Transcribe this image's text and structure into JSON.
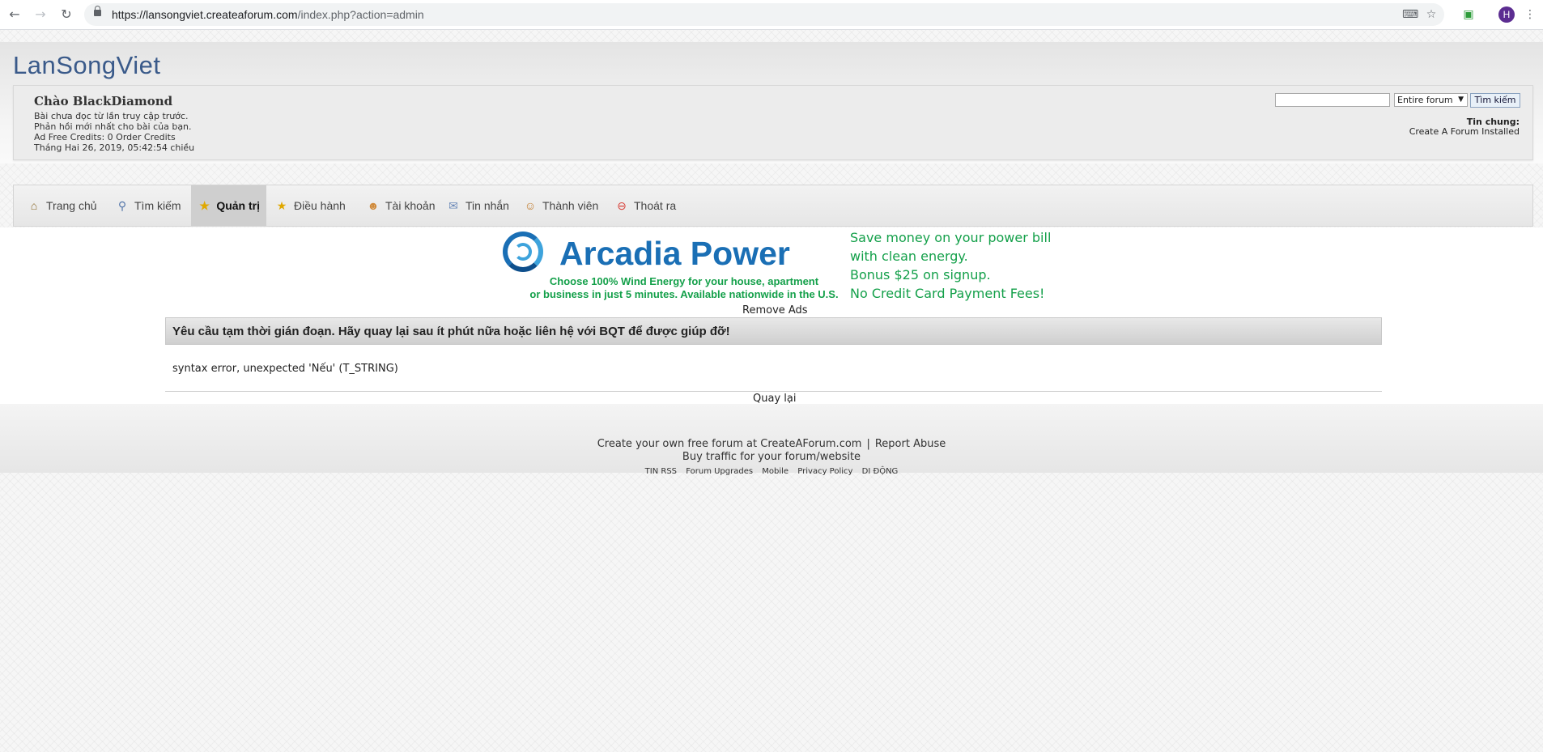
{
  "browser": {
    "url_host": "https://lansongviet.createaforum.com",
    "url_path": "/index.php?action=admin",
    "profile_initial": "H"
  },
  "site": {
    "title": "LanSongViet"
  },
  "user_box": {
    "greeting": "Chào BlackDiamond",
    "lines": [
      "Bài chưa đọc từ lần truy cập trước.",
      "Phản hồi mới nhất cho bài của bạn.",
      "Ad Free Credits: 0 Order Credits",
      "Tháng Hai 26, 2019, 05:42:54 chiều"
    ]
  },
  "search": {
    "input_value": "",
    "scope_selected": "Entire forum",
    "button_label": "Tìm kiếm"
  },
  "announcement": {
    "title": "Tin chung:",
    "text": "Create A Forum Installed"
  },
  "menu": {
    "items": [
      {
        "label": "Trang chủ",
        "icon": "home-icon"
      },
      {
        "label": "Tìm kiếm",
        "icon": "magnifier-icon"
      },
      {
        "label": "Quản trị",
        "icon": "star-icon",
        "active": true
      },
      {
        "label": "Điều hành",
        "icon": "star-icon"
      },
      {
        "label": "Tài khoản",
        "icon": "user-icon"
      },
      {
        "label": "Tin nhắn",
        "icon": "envelope-icon"
      },
      {
        "label": "Thành viên",
        "icon": "members-icon"
      },
      {
        "label": "Thoát ra",
        "icon": "logout-icon"
      }
    ]
  },
  "ad": {
    "brand": "Arcadia Power",
    "subtitle_1": "Choose 100% Wind Energy for your house, apartment",
    "subtitle_2": "or business in just 5 minutes. Available nationwide in the U.S.",
    "lines": [
      "Save money on your power bill",
      "with clean energy.",
      "Bonus $25 on signup.",
      "No Credit Card Payment Fees!"
    ],
    "remove_label": "Remove Ads",
    "brand_color": "#1a6fb5",
    "text_color": "#14a04a"
  },
  "error": {
    "title": "Yêu cầu tạm thời gián đoạn. Hãy quay lại sau ít phút nữa hoặc liên hệ với BQT để được giúp đỡ!",
    "message": "syntax error, unexpected 'Nếu' (T_STRING)",
    "back_label": "Quay lại"
  },
  "footer": {
    "create_text": "Create your own free forum at CreateAForum.com",
    "separator": "|",
    "report_abuse": "Report Abuse",
    "traffic_text": "Buy traffic for your forum/website",
    "links": [
      "TIN RSS",
      "Forum Upgrades",
      "Mobile",
      "Privacy Policy",
      "DI ĐỘNG"
    ]
  }
}
